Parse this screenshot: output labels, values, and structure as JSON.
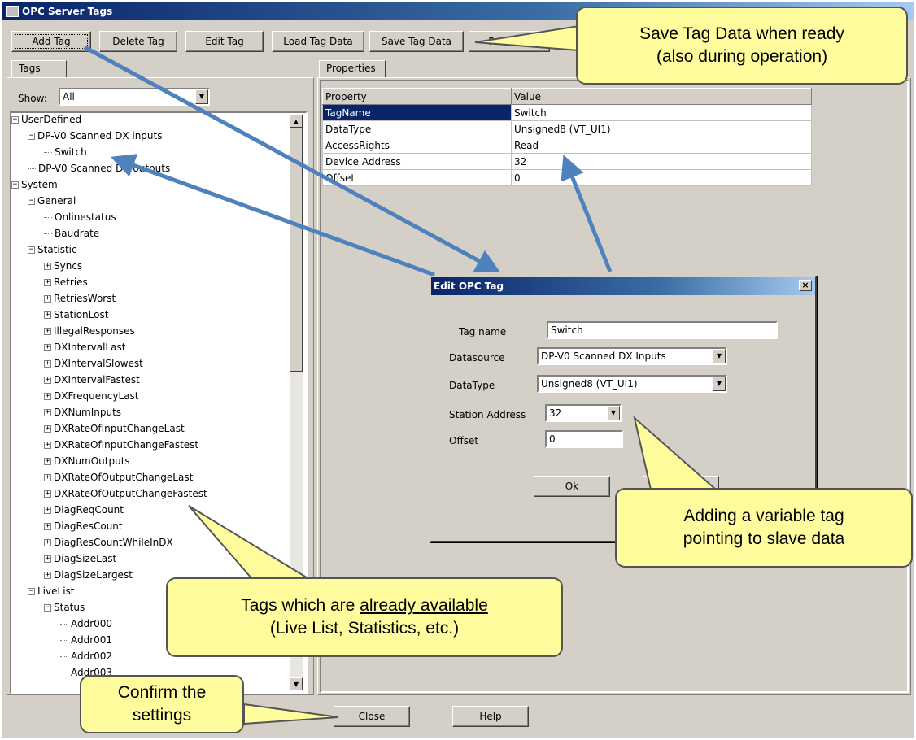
{
  "window": {
    "title": "OPC Server Tags"
  },
  "toolbar": {
    "add_tag": "Add Tag",
    "delete_tag": "Delete Tag",
    "edit_tag": "Edit Tag",
    "load_tag_data": "Load Tag Data",
    "save_tag_data": "Save Tag Data",
    "reset_all": "Reset all"
  },
  "left_panel": {
    "tab": "Tags",
    "show_label": "Show:",
    "show_value": "All"
  },
  "tree": {
    "rows": [
      {
        "label": "UserDefined",
        "indent": 0,
        "kind": "minus"
      },
      {
        "label": "DP-V0 Scanned DX inputs",
        "indent": 1,
        "kind": "minus"
      },
      {
        "label": "Switch",
        "indent": 2,
        "kind": "leaf"
      },
      {
        "label": "DP-V0 Scanned DX outputs",
        "indent": 1,
        "kind": "leaf"
      },
      {
        "label": "System",
        "indent": 0,
        "kind": "minus"
      },
      {
        "label": "General",
        "indent": 1,
        "kind": "minus"
      },
      {
        "label": "Onlinestatus",
        "indent": 2,
        "kind": "leaf"
      },
      {
        "label": "Baudrate",
        "indent": 2,
        "kind": "leaf"
      },
      {
        "label": "Statistic",
        "indent": 1,
        "kind": "minus"
      },
      {
        "label": "Syncs",
        "indent": 2,
        "kind": "plus"
      },
      {
        "label": "Retries",
        "indent": 2,
        "kind": "plus"
      },
      {
        "label": "RetriesWorst",
        "indent": 2,
        "kind": "plus"
      },
      {
        "label": "StationLost",
        "indent": 2,
        "kind": "plus"
      },
      {
        "label": "IllegalResponses",
        "indent": 2,
        "kind": "plus"
      },
      {
        "label": "DXIntervalLast",
        "indent": 2,
        "kind": "plus"
      },
      {
        "label": "DXIntervalSlowest",
        "indent": 2,
        "kind": "plus"
      },
      {
        "label": "DXIntervalFastest",
        "indent": 2,
        "kind": "plus"
      },
      {
        "label": "DXFrequencyLast",
        "indent": 2,
        "kind": "plus"
      },
      {
        "label": "DXNumInputs",
        "indent": 2,
        "kind": "plus"
      },
      {
        "label": "DXRateOfInputChangeLast",
        "indent": 2,
        "kind": "plus"
      },
      {
        "label": "DXRateOfInputChangeFastest",
        "indent": 2,
        "kind": "plus"
      },
      {
        "label": "DXNumOutputs",
        "indent": 2,
        "kind": "plus"
      },
      {
        "label": "DXRateOfOutputChangeLast",
        "indent": 2,
        "kind": "plus"
      },
      {
        "label": "DXRateOfOutputChangeFastest",
        "indent": 2,
        "kind": "plus"
      },
      {
        "label": "DiagReqCount",
        "indent": 2,
        "kind": "plus"
      },
      {
        "label": "DiagResCount",
        "indent": 2,
        "kind": "plus"
      },
      {
        "label": "DiagResCountWhileInDX",
        "indent": 2,
        "kind": "plus"
      },
      {
        "label": "DiagSizeLast",
        "indent": 2,
        "kind": "plus"
      },
      {
        "label": "DiagSizeLargest",
        "indent": 2,
        "kind": "plus"
      },
      {
        "label": "LiveList",
        "indent": 1,
        "kind": "minus"
      },
      {
        "label": "Status",
        "indent": 2,
        "kind": "minus"
      },
      {
        "label": "Addr000",
        "indent": 3,
        "kind": "leaf"
      },
      {
        "label": "Addr001",
        "indent": 3,
        "kind": "leaf"
      },
      {
        "label": "Addr002",
        "indent": 3,
        "kind": "leaf"
      },
      {
        "label": "Addr003",
        "indent": 3,
        "kind": "leaf"
      }
    ]
  },
  "right_panel": {
    "tab": "Properties",
    "columns": [
      "Property",
      "Value"
    ],
    "rows": [
      [
        "TagName",
        "Switch"
      ],
      [
        "DataType",
        "Unsigned8 (VT_UI1)"
      ],
      [
        "AccessRights",
        "Read"
      ],
      [
        "Device Address",
        "32"
      ],
      [
        "Offset",
        "0"
      ]
    ]
  },
  "dialog": {
    "title": "Edit OPC Tag",
    "tag_name_label": "Tag name",
    "tag_name_value": "Switch",
    "datasource_label": "Datasource",
    "datasource_value": "DP-V0 Scanned DX Inputs",
    "datatype_label": "DataType",
    "datatype_value": "Unsigned8 (VT_UI1)",
    "station_label": "Station Address",
    "station_value": "32",
    "offset_label": "Offset",
    "offset_value": "0",
    "ok": "Ok"
  },
  "bottom": {
    "close": "Close",
    "help": "Help"
  },
  "callouts": {
    "save": [
      "Save Tag Data when ready",
      "(also during operation)"
    ],
    "adding": [
      "Adding a variable tag",
      "pointing to slave data"
    ],
    "tags_pre": "Tags which are ",
    "tags_underline": "already available",
    "tags_line2": "(Live List, Statistics, etc.)",
    "confirm": [
      "Confirm the",
      "settings"
    ]
  },
  "colors": {
    "callout_fill": "#fffc9e",
    "arrow": "#4f81bd",
    "selection": "#0a246a"
  }
}
